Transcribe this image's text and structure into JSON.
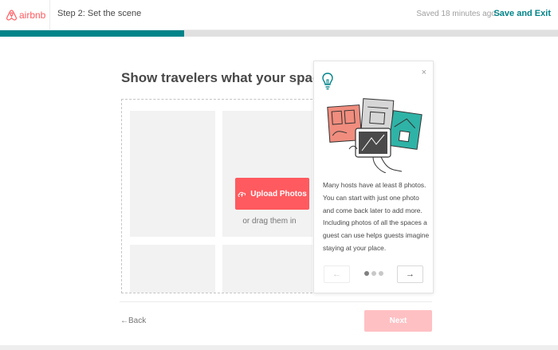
{
  "header": {
    "logo_text": "airbnb",
    "step_title": "Step 2: Set the scene",
    "saved_text": "Saved 18 minutes ago",
    "separator": "·",
    "save_exit_label": "Save and Exit",
    "progress_fraction": 0.33,
    "brand_color": "#ff5a5f",
    "accent_color": "#008489"
  },
  "main": {
    "title": "Show travelers what your space looks like",
    "upload_label": "Upload Photos",
    "drag_text": "or drag them in"
  },
  "tip": {
    "close_label": "×",
    "text": "Many hosts have at least 8 photos. You can start with just one photo and come back later to add more. Including photos of all the spaces a guest can use helps guests imagine staying at your place.",
    "prev_label": "←",
    "next_label": "→",
    "dots_total": 3,
    "dots_active": 1
  },
  "footer": {
    "back_label": "Back",
    "back_arrow": "←",
    "next_label": "Next"
  }
}
